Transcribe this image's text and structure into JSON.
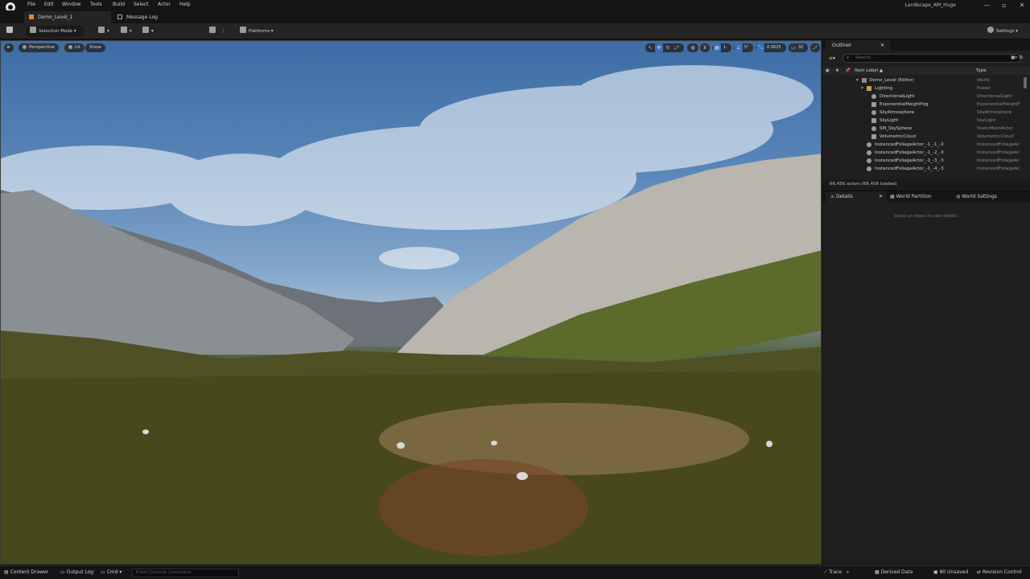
{
  "menu": [
    "File",
    "Edit",
    "Window",
    "Tools",
    "Build",
    "Select",
    "Actor",
    "Help"
  ],
  "window_title": "Landscape_AM_Huge",
  "window_buttons": [
    "—",
    "▫",
    "✕"
  ],
  "tabs": {
    "level": "Demo_Level_1",
    "message_log": "Message Log"
  },
  "toolbar": {
    "selection_mode": "Selection Mode",
    "platforms": "Platforms",
    "settings": "Settings"
  },
  "viewport": {
    "perspective": "Perspective",
    "lit": "Lit",
    "show": "Show",
    "grid_snap": "1",
    "rot_snap": "5°",
    "scale_snap": "0.0625",
    "cam_speed": "32"
  },
  "outliner": {
    "title": "Outliner",
    "search_placeholder": "Search...",
    "col_label": "Item Label ▲",
    "col_type": "Type",
    "rows": [
      {
        "label": "Demo_Level (Editor)",
        "type": "World"
      },
      {
        "label": "Lighting",
        "type": "Folder"
      },
      {
        "label": "DirectionalLight",
        "type": "DirectionalLight"
      },
      {
        "label": "ExponentialHeightFog",
        "type": "ExponentialHeightF"
      },
      {
        "label": "SkyAtmosphere",
        "type": "SkyAtmosphere"
      },
      {
        "label": "SkyLight",
        "type": "SkyLight"
      },
      {
        "label": "SM_SkySphere",
        "type": "StaticMeshActor"
      },
      {
        "label": "VolumetricCloud",
        "type": "VolumetricCloud"
      },
      {
        "label": "InstancedFoliageActor_-1_-1_-3",
        "type": "InstancedFoliageAc"
      },
      {
        "label": "InstancedFoliageActor_-1_-2_-3",
        "type": "InstancedFoliageAc"
      },
      {
        "label": "InstancedFoliageActor_-1_-3_-3",
        "type": "InstancedFoliageAc"
      },
      {
        "label": "InstancedFoliageActor_-1_-4_-3",
        "type": "InstancedFoliageAc"
      }
    ],
    "status": "66,456 actors (66,456 loaded)"
  },
  "details": {
    "title": "Details",
    "world_partition": "World Partition",
    "world_settings": "World Settings",
    "empty_msg": "Select an object to view details."
  },
  "statusbar": {
    "content_drawer": "Content Drawer",
    "output_log": "Output Log",
    "cmd": "Cmd",
    "console_placeholder": "Enter Console Command",
    "trace": "Trace",
    "derived_data": "Derived Data",
    "unsaved": "80 Unsaved",
    "revision_control": "Revision Control"
  },
  "colors": {
    "accent_play": "#37b34a",
    "panel_bg": "#1f1f1f",
    "toolbar_bg": "#242424"
  }
}
